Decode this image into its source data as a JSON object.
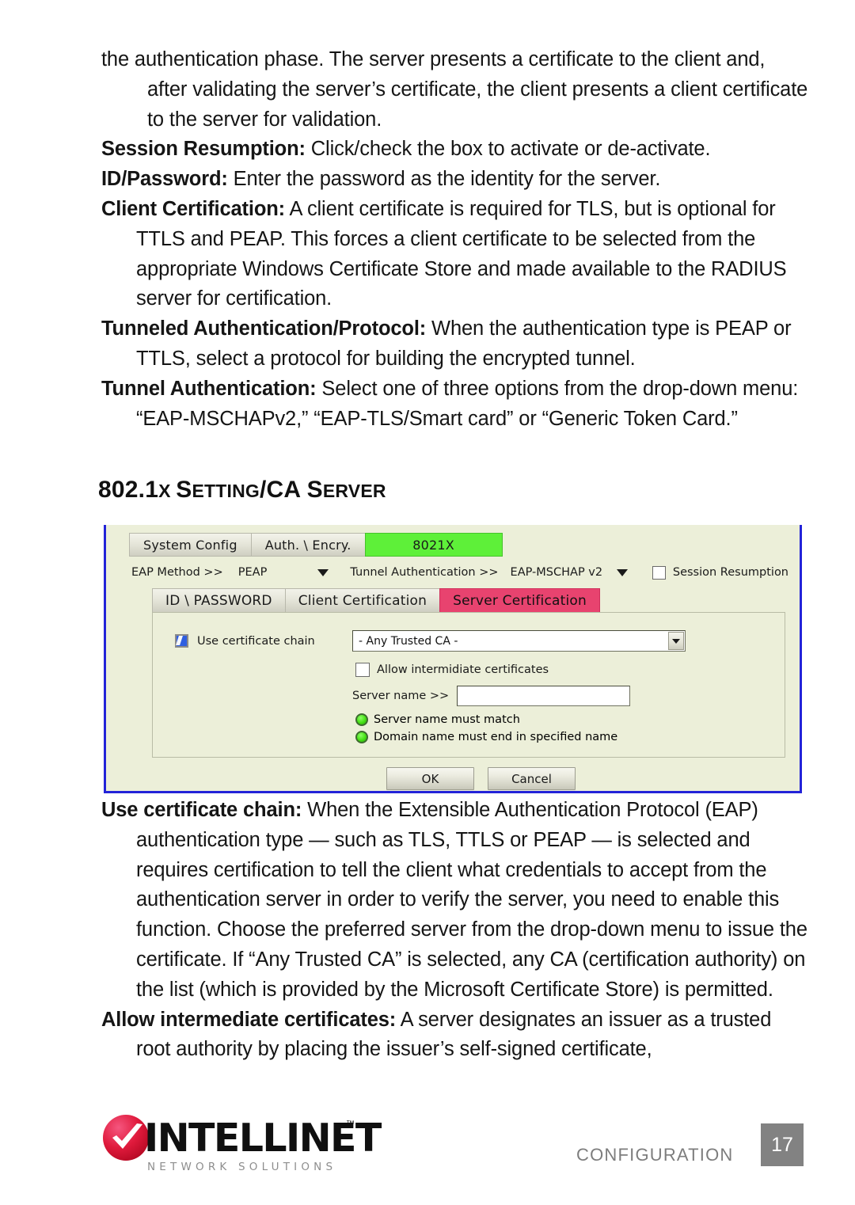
{
  "body_top": {
    "paragraphs": [
      {
        "lead": "",
        "text": "the authentication phase. The server presents a certificate to the client and, after validating the server’s certificate, the client presents a client certificate to the server for validation.",
        "style": "cont"
      },
      {
        "lead": "Session Resumption:",
        "text": " Click/check the box to activate or de-activate.",
        "style": "hang"
      },
      {
        "lead": "ID/Password:",
        "text": " Enter the password as the identity for the server.",
        "style": "hang"
      },
      {
        "lead": "Client Certification:",
        "text": " A client certificate is required for TLS, but is optional for TTLS and PEAP. This forces a client certificate to be selected from the appropriate Windows Certificate Store and made available to the RADIUS server for certification.",
        "style": "hang"
      },
      {
        "lead": "Tunneled Authentication/Protocol:",
        "text": " When the authentication type is PEAP or TTLS, select a protocol for building the encrypted tunnel.",
        "style": "hang"
      },
      {
        "lead": "Tunnel Authentication:",
        "text": " Select one of three options from the drop-down menu: “EAP-MSCHAPv2,” “EAP-TLS/Smart card” or “Generic Token Card.”",
        "style": "hang"
      }
    ]
  },
  "heading": {
    "part1": "802.1",
    "part2": "X ",
    "part3": "S",
    "part4": "ETTING",
    "part5": "/CA ",
    "part6": "S",
    "part7": "ERVER"
  },
  "figure": {
    "main_tabs": [
      {
        "label": "System Config",
        "state": "normal"
      },
      {
        "label": "Auth. \\ Encry.",
        "state": "normal"
      },
      {
        "label": "8021X",
        "state": "active-green"
      }
    ],
    "top_row": {
      "eap_method_label": "EAP Method >>",
      "eap_method_value": "PEAP",
      "tunnel_auth_label": "Tunnel Authentication >>",
      "tunnel_auth_value": "EAP-MSCHAP v2",
      "session_resumption_label": "Session Resumption",
      "session_resumption_checked": false
    },
    "sub_tabs": [
      {
        "label": "ID \\ PASSWORD",
        "state": "normal"
      },
      {
        "label": "Client Certification",
        "state": "normal"
      },
      {
        "label": "Server Certification",
        "state": "active-pink"
      }
    ],
    "panel": {
      "use_certificate_chain_label": "Use certificate chain",
      "use_certificate_chain_checked": true,
      "ca_select_value": "- Any Trusted CA -",
      "allow_intermediate_label": "Allow intermidiate certificates",
      "allow_intermediate_checked": false,
      "server_name_label": "Server name >>",
      "server_name_value": "",
      "radio_options": [
        "Server name must match",
        "Domain name must end in specified name"
      ]
    },
    "buttons": {
      "ok": "OK",
      "cancel": "Cancel"
    },
    "colors": {
      "window_bg": "#ecefd9",
      "border": "#2323d8",
      "active_tab_green": "#5ef039",
      "active_tab_pink": "#e8436f",
      "checkbox_checked": "#2f5fe0",
      "radio_green": "#45e014"
    }
  },
  "body_bottom": {
    "paragraphs": [
      {
        "lead": "Use certificate chain:",
        "text": " When the Extensible Authentication Protocol (EAP) authentication type — such as TLS, TTLS or PEAP — is selected and requires certification to tell the client what credentials to accept from the authentication server in order to verify the server, you need to enable this function. Choose the preferred server from the drop-down menu to issue the certificate. If “Any Trusted CA” is selected, any CA (certification authority) on the list (which is provided by the Microsoft Certificate Store) is permitted.",
        "style": "hang"
      },
      {
        "lead": "Allow intermediate certificates:",
        "text": " A server designates an issuer as a trusted root authority by placing the issuer’s self-signed certificate,",
        "style": "hang"
      }
    ]
  },
  "footer": {
    "brand": "INTELLINET",
    "brand_tm": "™",
    "tagline": "NETWORK SOLUTIONS",
    "section_label": "CONFIGURATION",
    "page_number": "17"
  }
}
